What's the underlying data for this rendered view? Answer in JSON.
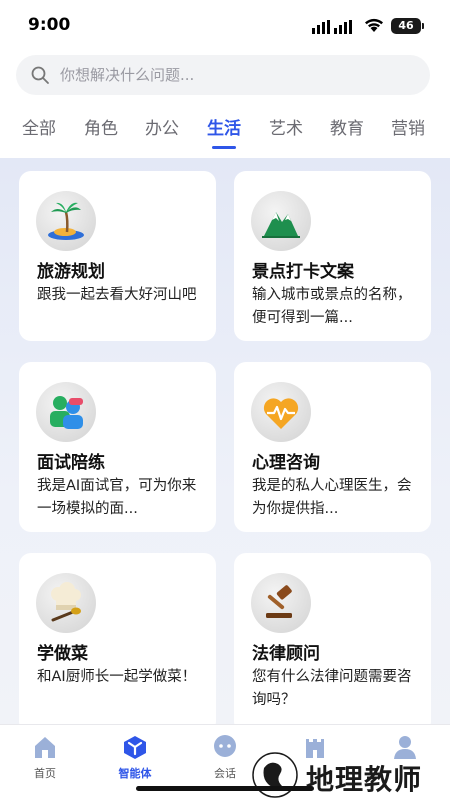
{
  "status_bar": {
    "time": "9:00",
    "battery": "46"
  },
  "search": {
    "placeholder": "你想解决什么问题..."
  },
  "tabs": [
    {
      "label": "全部"
    },
    {
      "label": "角色"
    },
    {
      "label": "办公"
    },
    {
      "label": "生活",
      "active": true
    },
    {
      "label": "艺术"
    },
    {
      "label": "教育"
    },
    {
      "label": "营销"
    }
  ],
  "cards": [
    {
      "title": "旅游规划",
      "desc": "跟我一起去看大好河山吧",
      "icon": "palm-island-icon"
    },
    {
      "title": "景点打卡文案",
      "desc": "输入城市或景点的名称，便可得到一篇...",
      "icon": "mountain-icon"
    },
    {
      "title": "面试陪练",
      "desc": "我是AI面试官，可为你来一场模拟的面...",
      "icon": "people-icon"
    },
    {
      "title": "心理咨询",
      "desc": "我是的私人心理医生，会为你提供指...",
      "icon": "heart-pulse-icon"
    },
    {
      "title": "学做菜",
      "desc": "和AI厨师长一起学做菜！",
      "icon": "chef-hat-icon"
    },
    {
      "title": "法律顾问",
      "desc": "您有什么法律问题需要咨询吗？",
      "icon": "gavel-icon"
    }
  ],
  "bottom_nav": [
    {
      "label": "首页",
      "icon": "home-icon"
    },
    {
      "label": "智能体",
      "icon": "cube-icon",
      "active": true
    },
    {
      "label": "会话",
      "icon": "chat-icon"
    },
    {
      "label": "",
      "icon": "castle-icon"
    },
    {
      "label": "",
      "icon": "person-icon"
    }
  ],
  "watermark": {
    "text": "地理教师"
  },
  "colors": {
    "accent": "#2f56e8",
    "background_gradient_top": "#e3e8f6",
    "card": "#ffffff"
  }
}
